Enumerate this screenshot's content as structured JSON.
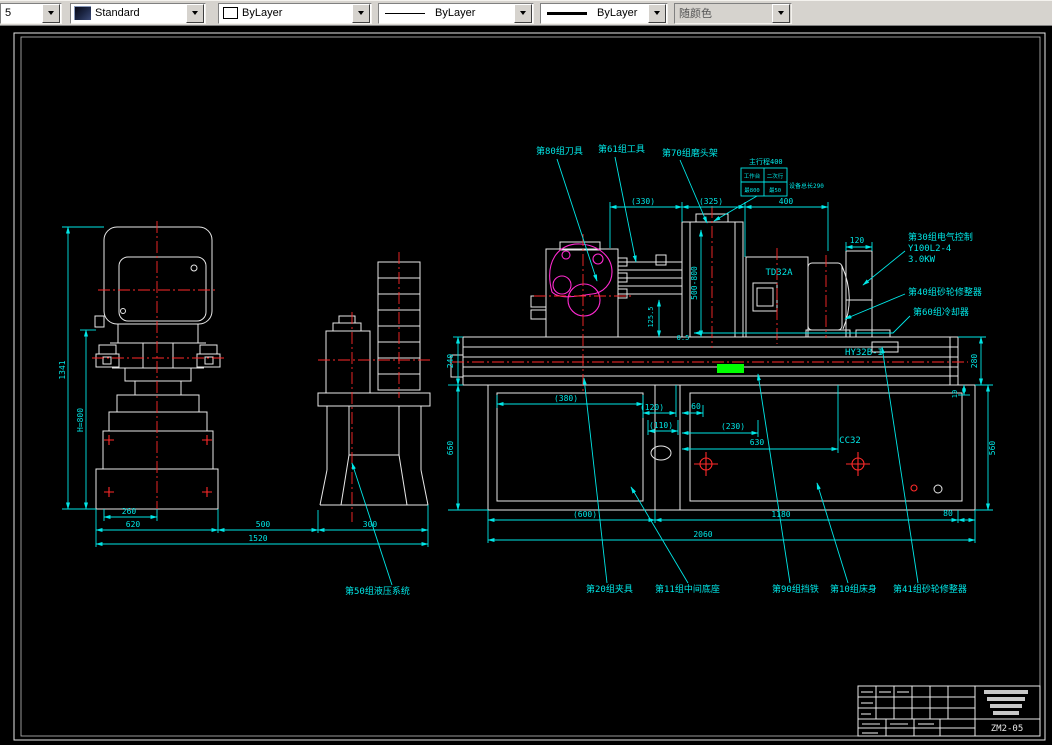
{
  "toolbar": {
    "combo_left": {
      "value": "5"
    },
    "style": {
      "value": "Standard"
    },
    "color": {
      "value": "ByLayer"
    },
    "linetype": {
      "value": "ByLayer"
    },
    "lineweight": {
      "value": "ByLayer"
    },
    "plot_style": {
      "value": "随颜色"
    }
  },
  "colors": {
    "dimension": "#00e6e6",
    "geometry": "#e8e8e8",
    "centerline": "#ff2a2a",
    "detail": "#ff2ad0",
    "highlight": "#00ff00",
    "background": "#000000"
  },
  "drawing": {
    "labels": {
      "tool80": "第80组刀具",
      "tool61": "第61组工具",
      "head70": "第70组磨头架",
      "elec30_l1": "第30组电气控制",
      "elec30_l2": "Y100L2-4",
      "elec30_l3": "3.0KW",
      "dresser40": "第40组砂轮修整器",
      "cool60": "第60组冷却器",
      "hyd50": "第50组液压系统",
      "fixture20": "第20组夹具",
      "base11": "第11组中间底座",
      "stop90": "第90组挡铁",
      "bed10": "第10组床身",
      "dresser41": "第41组砂轮修整器"
    },
    "models": {
      "wheelhead": "TD32A",
      "table_unit": "HY32B-I",
      "bed_unit": "CC32"
    },
    "aux": {
      "travel": "主行程400",
      "c11": "工作台",
      "c12": "二次行",
      "c21": "最800",
      "c22": "最50",
      "total": "设备总长290"
    },
    "dims": {
      "v1341": "1341",
      "vH800": "H=800",
      "h260": "260",
      "h620": "620",
      "h500": "500",
      "h300": "300",
      "h1520": "1520",
      "t330": "(330)",
      "t325": "(325)",
      "t400": "400",
      "t120": "120",
      "v500_800": "500-800",
      "v125": "125.5",
      "s05": "0.5",
      "v240": "240",
      "v660": "660",
      "v280": "280",
      "v560": "560",
      "v10": "10",
      "m380": "(380)",
      "m120": "(120)",
      "m110": "(110)",
      "m60": "60",
      "m230": "(230)",
      "m630": "630",
      "b600": "(600)",
      "b1180": "1180",
      "b80": "80",
      "b2060": "2060"
    },
    "title_block": {
      "drawing_no": "ZM2-05"
    }
  }
}
